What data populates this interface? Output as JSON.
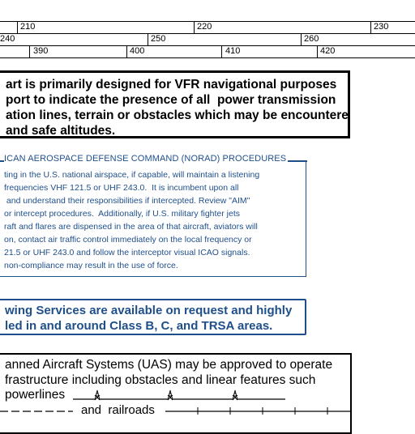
{
  "scale": {
    "row1": [
      "210",
      "220",
      "230"
    ],
    "row2": [
      "240",
      "250",
      "260"
    ],
    "row3": [
      "390",
      "400",
      "410",
      "420"
    ]
  },
  "vfr_note": {
    "lines": [
      "art is primarily designed for VFR navigational purposes",
      "port to indicate the presence of all  power transmission",
      "ation lines, terrain or obstacles which may be encountered",
      "and safe altitudes."
    ]
  },
  "norad": {
    "title": "ICAN AEROSPACE DEFENSE COMMAND (NORAD) PROCEDURES",
    "lines": [
      "ting in the U.S. national airspace, if capable, will maintain a listening",
      "frequencies VHF 121.5 or UHF 243.0.  It is incumbent upon all",
      " and understand their responsibilities if intercepted. Review \"AIM\"",
      "or intercept procedures.  Additionally, if U.S. military fighter jets",
      "raft and flares are dispensed in the area of that aircraft, aviators will",
      "on, contact air traffic control immediately on the local frequency or",
      "21.5 or UHF 243.0 and follow the interceptor visual ICAO signals.",
      "non-compliance may result in the use of force."
    ]
  },
  "towing": {
    "lines": [
      "wing Services are available on request and highly",
      "led in and around Class B, C, and TRSA areas."
    ]
  },
  "uas": {
    "lines": [
      "anned Aircraft Systems (UAS) may be approved to operate",
      "frastructure including obstacles and linear features such",
      "powerlines",
      "and  railroads"
    ]
  },
  "colors": {
    "norad_blue": "#1f4f8b",
    "text": "#000000"
  },
  "icons": [
    "power-tower-icon",
    "railroad-line-icon",
    "pipeline-dash-icon"
  ]
}
